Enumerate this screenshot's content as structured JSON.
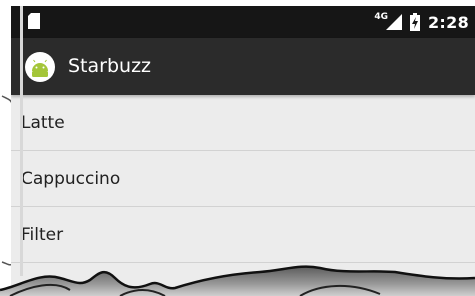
{
  "status_bar": {
    "network": "4G",
    "time": "2:28",
    "icons": [
      "sim-card-icon",
      "signal-icon",
      "battery-charging-icon"
    ]
  },
  "app_bar": {
    "title": "Starbuzz",
    "icon": "android-icon"
  },
  "list": {
    "items": [
      {
        "label": "Latte"
      },
      {
        "label": "Cappuccino"
      },
      {
        "label": "Filter"
      }
    ]
  },
  "colors": {
    "status_bar": "#161616",
    "app_bar": "#2b2b2b",
    "android_green": "#a4c639",
    "list_background": "#ececec",
    "divider": "#d2d2d2"
  }
}
